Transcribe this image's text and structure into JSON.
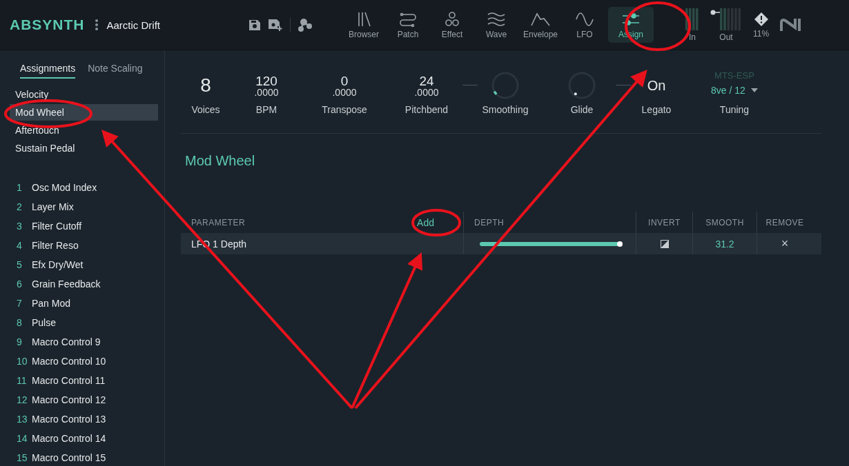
{
  "header": {
    "logo": "ABSYNTH",
    "preset": "Aarctic Drift",
    "cpu": "11%"
  },
  "nav": [
    {
      "label": "Browser",
      "selected": false
    },
    {
      "label": "Patch",
      "selected": false
    },
    {
      "label": "Effect",
      "selected": false
    },
    {
      "label": "Wave",
      "selected": false
    },
    {
      "label": "Envelope",
      "selected": false
    },
    {
      "label": "LFO",
      "selected": false
    },
    {
      "label": "Assign",
      "selected": true
    }
  ],
  "meters": [
    {
      "label": "In"
    },
    {
      "label": "Out"
    }
  ],
  "sidebar": {
    "tabs": [
      {
        "label": "Assignments",
        "selected": true
      },
      {
        "label": "Note Scaling",
        "selected": false
      }
    ],
    "sources": [
      {
        "label": "Velocity",
        "selected": false
      },
      {
        "label": "Mod Wheel",
        "selected": true
      },
      {
        "label": "Aftertouch",
        "selected": false
      },
      {
        "label": "Sustain Pedal",
        "selected": false
      }
    ],
    "macros": [
      {
        "number": "1",
        "name": "Osc Mod Index"
      },
      {
        "number": "2",
        "name": "Layer Mix"
      },
      {
        "number": "3",
        "name": "Filter Cutoff"
      },
      {
        "number": "4",
        "name": "Filter Reso"
      },
      {
        "number": "5",
        "name": "Efx Dry/Wet"
      },
      {
        "number": "6",
        "name": "Grain Feedback"
      },
      {
        "number": "7",
        "name": "Pan Mod"
      },
      {
        "number": "8",
        "name": "Pulse"
      },
      {
        "number": "9",
        "name": "Macro Control 9"
      },
      {
        "number": "10",
        "name": "Macro Control 10"
      },
      {
        "number": "11",
        "name": "Macro Control 11"
      },
      {
        "number": "12",
        "name": "Macro Control 12"
      },
      {
        "number": "13",
        "name": "Macro Control 13"
      },
      {
        "number": "14",
        "name": "Macro Control 14"
      },
      {
        "number": "15",
        "name": "Macro Control 15"
      }
    ]
  },
  "globals": [
    {
      "kind": "value",
      "value": "8",
      "label": "Voices"
    },
    {
      "kind": "fraction",
      "value": "120",
      "fraction": ".0000",
      "label": "BPM"
    },
    {
      "kind": "fraction",
      "value": "0",
      "fraction": ".0000",
      "label": "Transpose"
    },
    {
      "kind": "fraction",
      "value": "24",
      "fraction": ".0000",
      "label": "Pitchbend"
    },
    {
      "kind": "knob",
      "label": "Smoothing"
    },
    {
      "kind": "knob",
      "label": "Glide"
    },
    {
      "kind": "value",
      "value": "On",
      "label": "Legato"
    },
    {
      "kind": "dropdown",
      "caption": "MTS-ESP",
      "value": "8ve / 12",
      "label": "Tuning"
    }
  ],
  "section_title": "Mod Wheel",
  "table": {
    "columns": [
      {
        "label": "PARAMETER"
      },
      {
        "label": "DEPTH"
      },
      {
        "label": "INVERT"
      },
      {
        "label": "SMOOTH"
      },
      {
        "label": "REMOVE"
      }
    ],
    "add": "Add",
    "rows": [
      {
        "parameter": "LFO 1 Depth",
        "level": 1.0,
        "smooth": "31.2",
        "remove": "×"
      }
    ]
  }
}
